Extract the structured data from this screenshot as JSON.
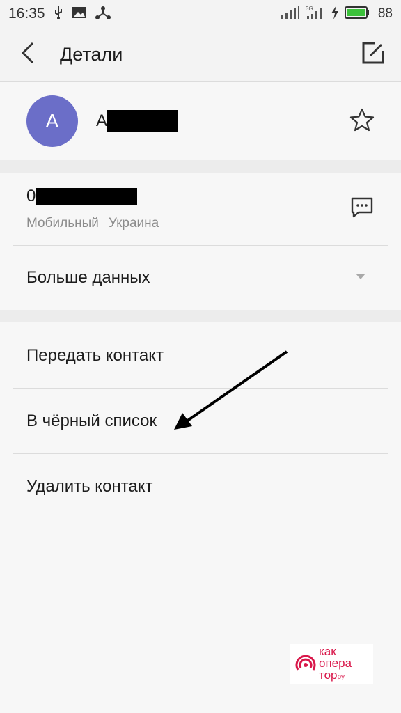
{
  "status_bar": {
    "time": "16:35",
    "battery_percent": "88",
    "icons_left": [
      "usb-icon",
      "image-icon",
      "share-icon"
    ],
    "icons_right": [
      "signal-icon",
      "signal-3g-icon",
      "charging-icon",
      "battery-icon"
    ]
  },
  "app_bar": {
    "title": "Детали"
  },
  "contact": {
    "avatar_letter": "А",
    "name_visible": "А",
    "avatar_color": "#6b6ec8"
  },
  "phone": {
    "number_visible": "0",
    "type": "Мобильный",
    "region": "Украина"
  },
  "more": {
    "label": "Больше данных"
  },
  "actions": [
    {
      "label": "Передать контакт"
    },
    {
      "label": "В чёрный список"
    },
    {
      "label": "Удалить контакт"
    }
  ],
  "watermark": {
    "line1": "как",
    "line2": "опера",
    "line3": "тор",
    "suffix": "ру",
    "color": "#d9174a"
  }
}
